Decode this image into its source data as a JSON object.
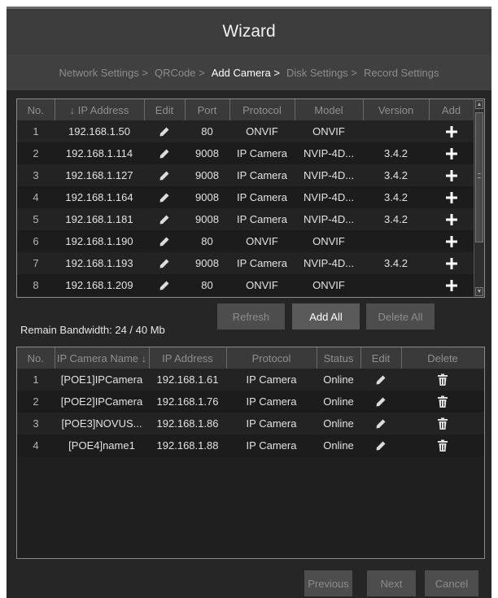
{
  "title": "Wizard",
  "steps": [
    {
      "label": "Network Settings >",
      "active": false
    },
    {
      "label": "QRCode >",
      "active": false
    },
    {
      "label": "Add Camera >",
      "active": true
    },
    {
      "label": "Disk Settings >",
      "active": false
    },
    {
      "label": "Record Settings",
      "active": false
    }
  ],
  "search_grid": {
    "headers": {
      "no": "No.",
      "sort_arrow": "↓",
      "ip": "IP Address",
      "edit": "Edit",
      "port": "Port",
      "protocol": "Protocol",
      "model": "Model",
      "version": "Version",
      "add": "Add"
    },
    "rows": [
      {
        "no": "1",
        "ip": "192.168.1.50",
        "port": "80",
        "protocol": "ONVIF",
        "model": "ONVIF",
        "version": ""
      },
      {
        "no": "2",
        "ip": "192.168.1.114",
        "port": "9008",
        "protocol": "IP Camera",
        "model": "NVIP-4D...",
        "version": "3.4.2"
      },
      {
        "no": "3",
        "ip": "192.168.1.127",
        "port": "9008",
        "protocol": "IP Camera",
        "model": "NVIP-4D...",
        "version": "3.4.2"
      },
      {
        "no": "4",
        "ip": "192.168.1.164",
        "port": "9008",
        "protocol": "IP Camera",
        "model": "NVIP-4D...",
        "version": "3.4.2"
      },
      {
        "no": "5",
        "ip": "192.168.1.181",
        "port": "9008",
        "protocol": "IP Camera",
        "model": "NVIP-4D...",
        "version": "3.4.2"
      },
      {
        "no": "6",
        "ip": "192.168.1.190",
        "port": "80",
        "protocol": "ONVIF",
        "model": "ONVIF",
        "version": ""
      },
      {
        "no": "7",
        "ip": "192.168.1.193",
        "port": "9008",
        "protocol": "IP Camera",
        "model": "NVIP-4D...",
        "version": "3.4.2"
      },
      {
        "no": "8",
        "ip": "192.168.1.209",
        "port": "80",
        "protocol": "ONVIF",
        "model": "ONVIF",
        "version": ""
      }
    ]
  },
  "buttons": {
    "refresh": "Refresh",
    "add_all": "Add All",
    "delete_all": "Delete All",
    "previous": "Previous",
    "next": "Next",
    "cancel": "Cancel"
  },
  "bandwidth": "Remain Bandwidth: 24 / 40 Mb",
  "added_grid": {
    "headers": {
      "no": "No.",
      "name": "IP Camera Name",
      "sort_arrow": "↓",
      "ip": "IP Address",
      "protocol": "Protocol",
      "status": "Status",
      "edit": "Edit",
      "delete": "Delete"
    },
    "rows": [
      {
        "no": "1",
        "name": "[POE1]IPCamera",
        "ip": "192.168.1.61",
        "protocol": "IP Camera",
        "status": "Online"
      },
      {
        "no": "2",
        "name": "[POE2]IPCamera",
        "ip": "192.168.1.76",
        "protocol": "IP Camera",
        "status": "Online"
      },
      {
        "no": "3",
        "name": "[POE3]NOVUS...",
        "ip": "192.168.1.86",
        "protocol": "IP Camera",
        "status": "Online"
      },
      {
        "no": "4",
        "name": "[POE4]name1",
        "ip": "192.168.1.88",
        "protocol": "IP Camera",
        "status": "Online"
      }
    ]
  },
  "icons": {
    "edit": "pencil-icon",
    "add": "plus-icon",
    "delete": "trash-icon"
  },
  "colors": {
    "background": "#262626",
    "header_bg": "#3a3a3a",
    "active_step": "#ffffff",
    "inactive_step": "#8c8c8c"
  }
}
